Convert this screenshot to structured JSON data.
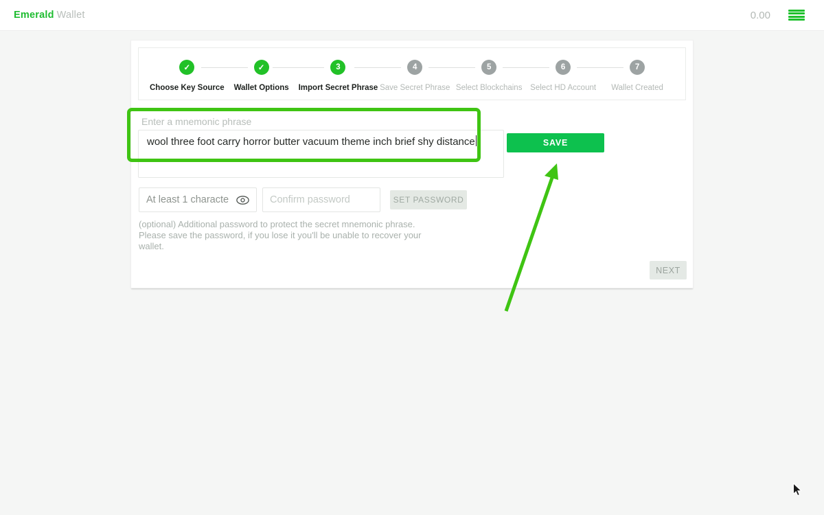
{
  "topbar": {
    "brand_primary": "Emerald",
    "brand_secondary": "Wallet",
    "balance": "0.00"
  },
  "stepper": {
    "steps": [
      {
        "label": "Choose Key Source",
        "state": "done",
        "glyph": "✓"
      },
      {
        "label": "Wallet Options",
        "state": "done",
        "glyph": "✓"
      },
      {
        "label": "Import Secret Phrase",
        "state": "active",
        "glyph": "3"
      },
      {
        "label": "Save Secret Phrase",
        "state": "future",
        "glyph": "4"
      },
      {
        "label": "Select Blockchains",
        "state": "future",
        "glyph": "5"
      },
      {
        "label": "Select HD Account",
        "state": "future",
        "glyph": "6"
      },
      {
        "label": "Wallet Created",
        "state": "future",
        "glyph": "7"
      }
    ]
  },
  "mnemonic": {
    "label": "Enter a mnemonic phrase",
    "value": "wool three foot carry horror butter vacuum theme inch brief shy distance",
    "save_button": "SAVE"
  },
  "password": {
    "password_placeholder": "At least 1 characte",
    "confirm_placeholder": "Confirm password",
    "set_button": "SET PASSWORD",
    "note": "(optional) Additional password to protect the secret mnemonic phrase. Please save the password, if you lose it you'll be unable to recover your wallet."
  },
  "footer": {
    "next_button": "NEXT"
  },
  "colors": {
    "accent_green": "#22c128",
    "save_green": "#0dc14e",
    "annotation_green": "#3fc413",
    "disabled_gray": "#e4e9e4"
  }
}
